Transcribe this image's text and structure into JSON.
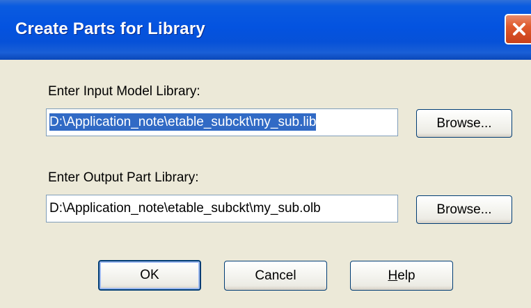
{
  "window": {
    "title": "Create Parts for Library",
    "close_icon": "close-icon"
  },
  "input_section": {
    "label": "Enter Input Model Library:",
    "value": "D:\\Application_note\\etable_subckt\\my_sub.lib",
    "browse_label": "Browse..."
  },
  "output_section": {
    "label": "Enter Output Part Library:",
    "value": "D:\\Application_note\\etable_subckt\\my_sub.olb",
    "browse_label": "Browse..."
  },
  "buttons": {
    "ok": "OK",
    "cancel": "Cancel",
    "help_mnemonic": "H",
    "help_rest": "elp"
  },
  "colors": {
    "titlebar": "#0453e0",
    "dialog_bg": "#ece9d8",
    "selection": "#316ac5",
    "close_button": "#e05a2c"
  }
}
